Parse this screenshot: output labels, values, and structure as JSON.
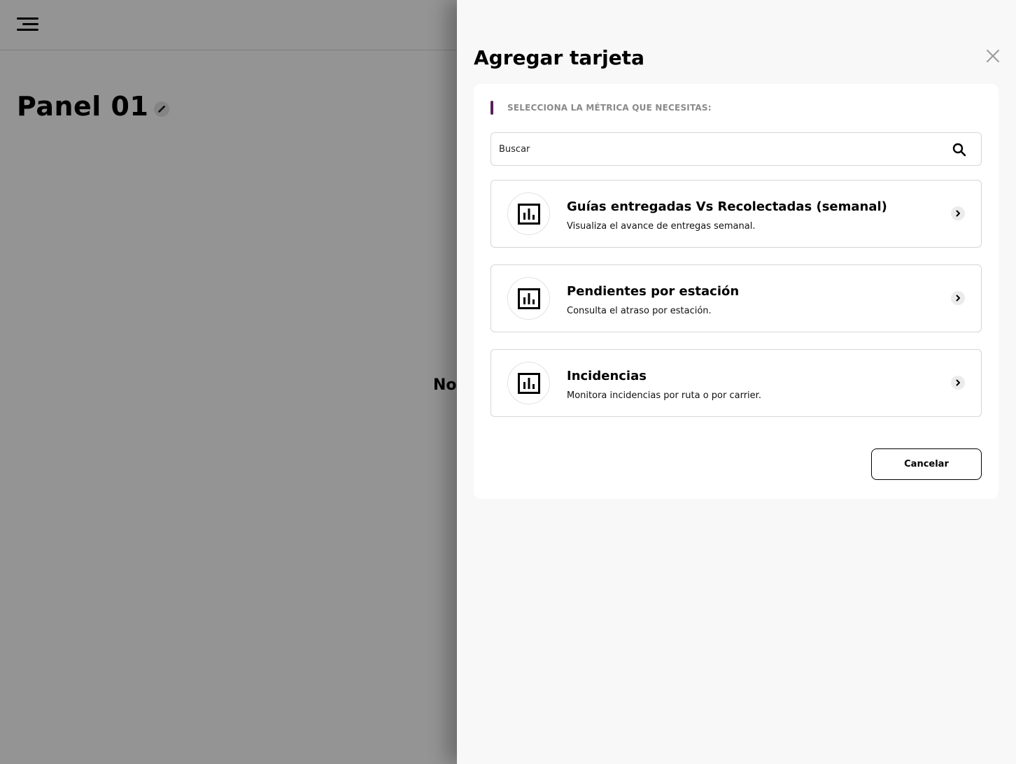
{
  "page": {
    "title": "Panel 01",
    "empty_message": "No"
  },
  "drawer": {
    "title": "Agregar tarjeta",
    "section_label": "SELECCIONA LA MÉTRICA QUE NECESITAS:",
    "search": {
      "placeholder": "Buscar",
      "value": ""
    },
    "metrics": [
      {
        "title": "Guías entregadas Vs Recolectadas (semanal)",
        "description": "Visualiza el avance de entregas semanal.",
        "icon": "bar-chart-icon"
      },
      {
        "title": "Pendientes por estación",
        "description": "Consulta el atraso por estación.",
        "icon": "bar-chart-icon"
      },
      {
        "title": "Incidencias",
        "description": "Monitora incidencias por ruta o por carrier.",
        "icon": "bar-chart-icon"
      }
    ],
    "cancel_label": "Cancelar"
  },
  "colors": {
    "accent": "#5b1f5b",
    "overlay": "rgba(0,0,0,0.42)",
    "drawer_bg": "#f8f8f8"
  }
}
